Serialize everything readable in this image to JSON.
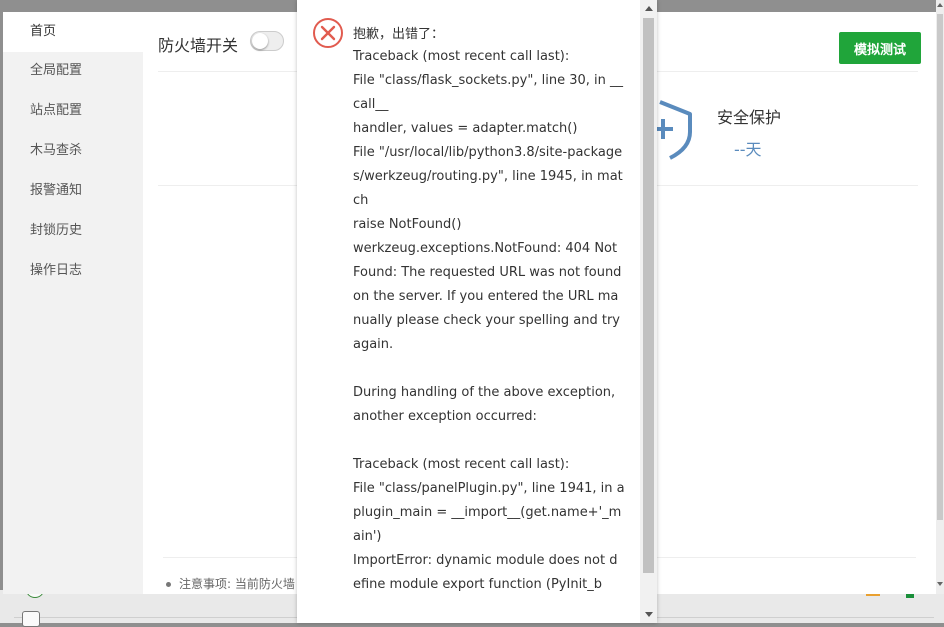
{
  "sidebar": {
    "items": [
      {
        "label": "首页",
        "active": true
      },
      {
        "label": "全局配置"
      },
      {
        "label": "站点配置"
      },
      {
        "label": "木马查杀"
      },
      {
        "label": "报警通知"
      },
      {
        "label": "封锁历史"
      },
      {
        "label": "操作日志"
      }
    ]
  },
  "main": {
    "firewall_label": "防火墙开关",
    "firewall_enabled": false,
    "test_button": "模拟测试",
    "protection_label": "安全保护",
    "protection_days": "--天",
    "notice": "注意事项: 当前防火墙"
  },
  "error_popup": {
    "title": "抱歉，出错了：",
    "message": "Traceback (most recent call last):\nFile \"class/flask_sockets.py\", line 30, in __call__\nhandler, values = adapter.match()\nFile \"/usr/local/lib/python3.8/site-packages/werkzeug/routing.py\", line 1945, in match\nraise NotFound()\nwerkzeug.exceptions.NotFound: 404 Not Found: The requested URL was not found on the server. If you entered the URL manually please check your spelling and try again.\n\nDuring handling of the above exception, another exception occurred:\n\nTraceback (most recent call last):\nFile \"class/panelPlugin.py\", line 1941, in a\nplugin_main = __import__(get.name+'_main')\nImportError: dynamic module does not define module export function (PyInit_b"
  },
  "colors": {
    "accent_green": "#20a53a",
    "error_red": "#e15b4f",
    "shield_blue": "#5a8bbd"
  }
}
